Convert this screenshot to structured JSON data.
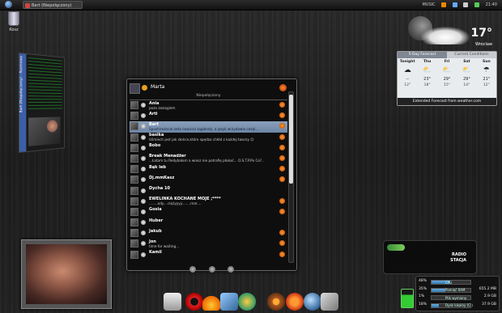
{
  "taskbar": {
    "window_button": "Bart (Niepołączony)",
    "music_label": "MUSIC",
    "clock": "21:40"
  },
  "desktop": {
    "recycle_bin": "Kosz"
  },
  "left_pane": {
    "title": "Bart (Niepołączony) - Rozmowa"
  },
  "messenger": {
    "user": "Marta",
    "group": "Niepołączony",
    "contacts": [
      {
        "name": "Ania",
        "desc": "poza zasięgiem",
        "selected": false,
        "gg": true
      },
      {
        "name": "Arti",
        "desc": "",
        "selected": false,
        "gg": true
      },
      {
        "name": "Bart",
        "desc": "Spostrzeżenie zeta nowicza ząglandy, a język wrzydowie ceząl...",
        "selected": true,
        "gg": true
      },
      {
        "name": "basika",
        "desc": "Uśmiech jest jak słońce,które spędza chłód z każdej twarzy ☺",
        "selected": false,
        "gg": true
      },
      {
        "name": "Bobo",
        "desc": "",
        "selected": false,
        "gg": true
      },
      {
        "name": "Break Menadżer",
        "desc": "...Łatam tu Redybałam a wiesz nie potrafię płakać... O.S.T.P.Po Co?..",
        "selected": false,
        "gg": true
      },
      {
        "name": "Bąk leb",
        "desc": "",
        "selected": false,
        "gg": true
      },
      {
        "name": "Dj.mmKasz",
        "desc": "",
        "selected": false,
        "gg": true
      },
      {
        "name": "Dycha 10",
        "desc": "",
        "selected": false,
        "gg": false
      },
      {
        "name": "EWELINKA KOCHANE MOJE ;****",
        "desc": "........ody....ciężyyyy........mar....",
        "selected": false,
        "gg": true
      },
      {
        "name": "Gosia",
        "desc": "",
        "selected": false,
        "gg": true
      },
      {
        "name": "Huber",
        "desc": "",
        "selected": false,
        "gg": false
      },
      {
        "name": "Jakub",
        "desc": "",
        "selected": false,
        "gg": true
      },
      {
        "name": "Jon",
        "desc": "time for waiting...",
        "selected": false,
        "gg": true
      },
      {
        "name": "Kamil",
        "desc": "",
        "selected": false,
        "gg": true
      }
    ]
  },
  "weather": {
    "temp": "17°",
    "city": "Wroclaw",
    "tab_forecast": "5-Day Forecast",
    "tab_current": "Current Conditions",
    "days": [
      "Tonight",
      "Thu",
      "Fri",
      "Sat",
      "Sun"
    ],
    "icons": [
      "☁",
      "⛅",
      "⛅",
      "⛅",
      "☂"
    ],
    "highs": [
      "--",
      "23°",
      "29°",
      "29°",
      "21°"
    ],
    "lows": [
      "12°",
      "18°",
      "15°",
      "14°",
      "12°"
    ],
    "footer": "Extended Forecast from weather.com"
  },
  "radio": {
    "line1": "RADIO",
    "line2": "STACJA"
  },
  "system": {
    "rows": [
      {
        "pct": "48%",
        "label": "CPU",
        "value": "",
        "fill": 0.48
      },
      {
        "pct": "35%",
        "label": "Pamięć RAM",
        "value": "655.2 MB",
        "fill": 0.35
      },
      {
        "pct": "1%",
        "label": "Plik wymiany",
        "value": "2.9 GB",
        "fill": 0.01
      },
      {
        "pct": "18%",
        "label": "Dysk lokalny (C:)",
        "value": "37.9 GB",
        "fill": 0.18
      }
    ]
  },
  "colors": {
    "accent": "#6d85a6",
    "gadu_orange": "#e8802a"
  }
}
